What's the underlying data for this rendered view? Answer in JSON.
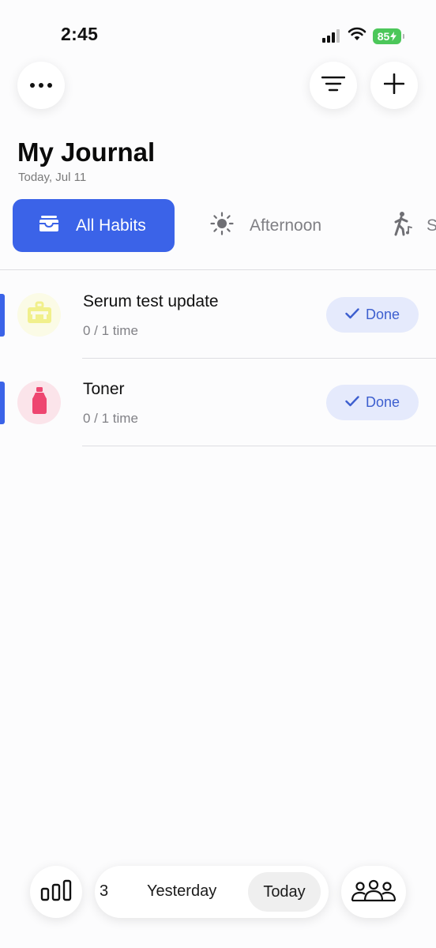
{
  "status_bar": {
    "time": "2:45",
    "battery": "85",
    "icons": [
      "cellular-signal-icon",
      "wifi-icon",
      "battery-charging-icon"
    ]
  },
  "header": {
    "title": "My Journal",
    "date": "Today, Jul 11",
    "buttons": [
      "more-icon",
      "sort-icon",
      "plus-icon"
    ]
  },
  "tabs": [
    {
      "label": "All Habits",
      "icon": "tray-icon",
      "active": true
    },
    {
      "label": "Afternoon",
      "icon": "sun-icon",
      "active": false
    },
    {
      "label": "S",
      "icon": "walking-icon",
      "active": false
    }
  ],
  "habits": [
    {
      "name": "Serum test update",
      "progress": "0 / 1 time",
      "done_label": "Done",
      "icon": "toolbox-icon",
      "icon_color": "#f4f3a0",
      "icon_bg": "#fbfbe6"
    },
    {
      "name": "Toner",
      "progress": "0 / 1 time",
      "done_label": "Done",
      "icon": "bottle-icon",
      "icon_color": "#ee4670",
      "icon_bg": "#fbe4ea"
    }
  ],
  "bottom_bar": {
    "date_partial": "3",
    "yesterday": "Yesterday",
    "today": "Today",
    "icons": [
      "bar-chart-icon",
      "group-icon"
    ]
  },
  "colors": {
    "accent": "#3b63e8",
    "done_bg": "#e5eafc",
    "done_text": "#3d5fcf"
  }
}
